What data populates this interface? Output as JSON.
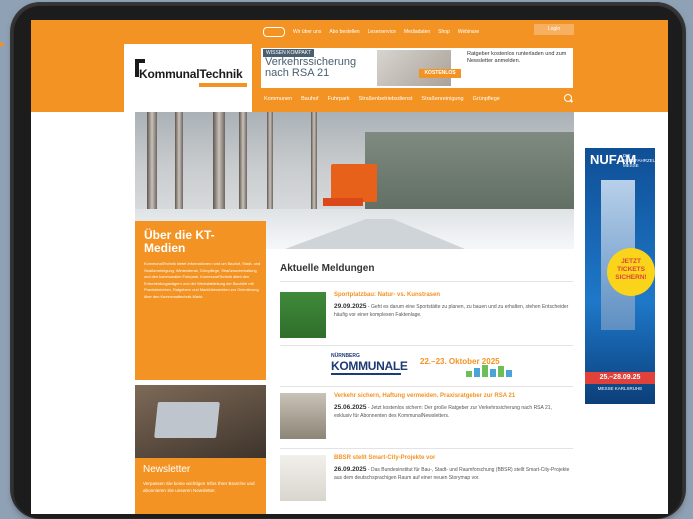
{
  "site": {
    "logo_name": "KommunalTechnik",
    "top_nav": [
      "Wir über uns",
      "Abo bestellen",
      "Leserservice",
      "Mediadaten",
      "Shop",
      "Webinare"
    ],
    "login_label": "Login"
  },
  "banner": {
    "kicker": "WISSEN KOMPAKT",
    "title": "Verkehrssicherung nach RSA 21",
    "badge": "KOSTENLOS",
    "copy": "Ratgeber kostenlos runterladen und zum Newsletter anmelden."
  },
  "section_nav": [
    "Kommunen",
    "Bauhof",
    "Fuhrpark",
    "Straßenbetriebsdienst",
    "Straßenreinigung",
    "Grünpflege"
  ],
  "about": {
    "title": "Über die KT-Medien",
    "text": "KommunalTechnik bietet Informationen rund um Bauhof, Stadt- und Straßenreinigung, Winterdienst, Grünpflege, Straßenunterhaltung und den kommunalen Fuhrpark. KommunalTechnik dient den Entscheidungsträgern und der Werkstattleitung der Bauhöfe mit Praxisberichten, Ratgebern und Marktübersichten zur Orientierung über den Kommunaltechnik-Markt."
  },
  "newsletter": {
    "title": "Newsletter",
    "text": "Verpassen Sie keine wichtigen Infos Ihrer Branche und abonnieren Sie unseren Newsletter."
  },
  "news": {
    "heading": "Aktuelle Meldungen",
    "items": [
      {
        "title": "Sportplatzbau: Natur- vs. Kunstrasen",
        "date": "29.09.2025",
        "body": " - Geht es darum eine Sportstätte zu planen, zu bauen und zu erhalten, stehen Entscheider häufig vor einer komplexen Faktenlage."
      },
      {
        "title": "Verkehr sichern, Haftung vermeiden. Praxisratgeber zur RSA 21",
        "date": "25.06.2025",
        "body": " - Jetzt kostenlos sichern: Der große Ratgeber zur Verkehrssicherung nach RSA 21, exklusiv für Abonnenten des KommunalNewsletters."
      },
      {
        "title": "BBSR stellt Smart-City-Projekte vor",
        "date": "26.09.2025",
        "body": " - Das Bundesinstitut für Bau-, Stadt- und Raumforschung (BBSR) stellt Smart-City-Projekte aus dem deutschsprachigen Raum auf einer neuen Storymap vor."
      }
    ]
  },
  "nk_banner": {
    "small": "NÜRNBERG",
    "big": "KOMMUNALE",
    "date": "22.–23. Oktober 2025"
  },
  "side_ad": {
    "title": "NUFAM",
    "title2": "DIE NUTZFAHRZEUG MESSE",
    "badge": "JETZT TICKETS SICHERN!",
    "date": "25.–28.09.25",
    "place": "MESSE KARLSRUHE"
  }
}
